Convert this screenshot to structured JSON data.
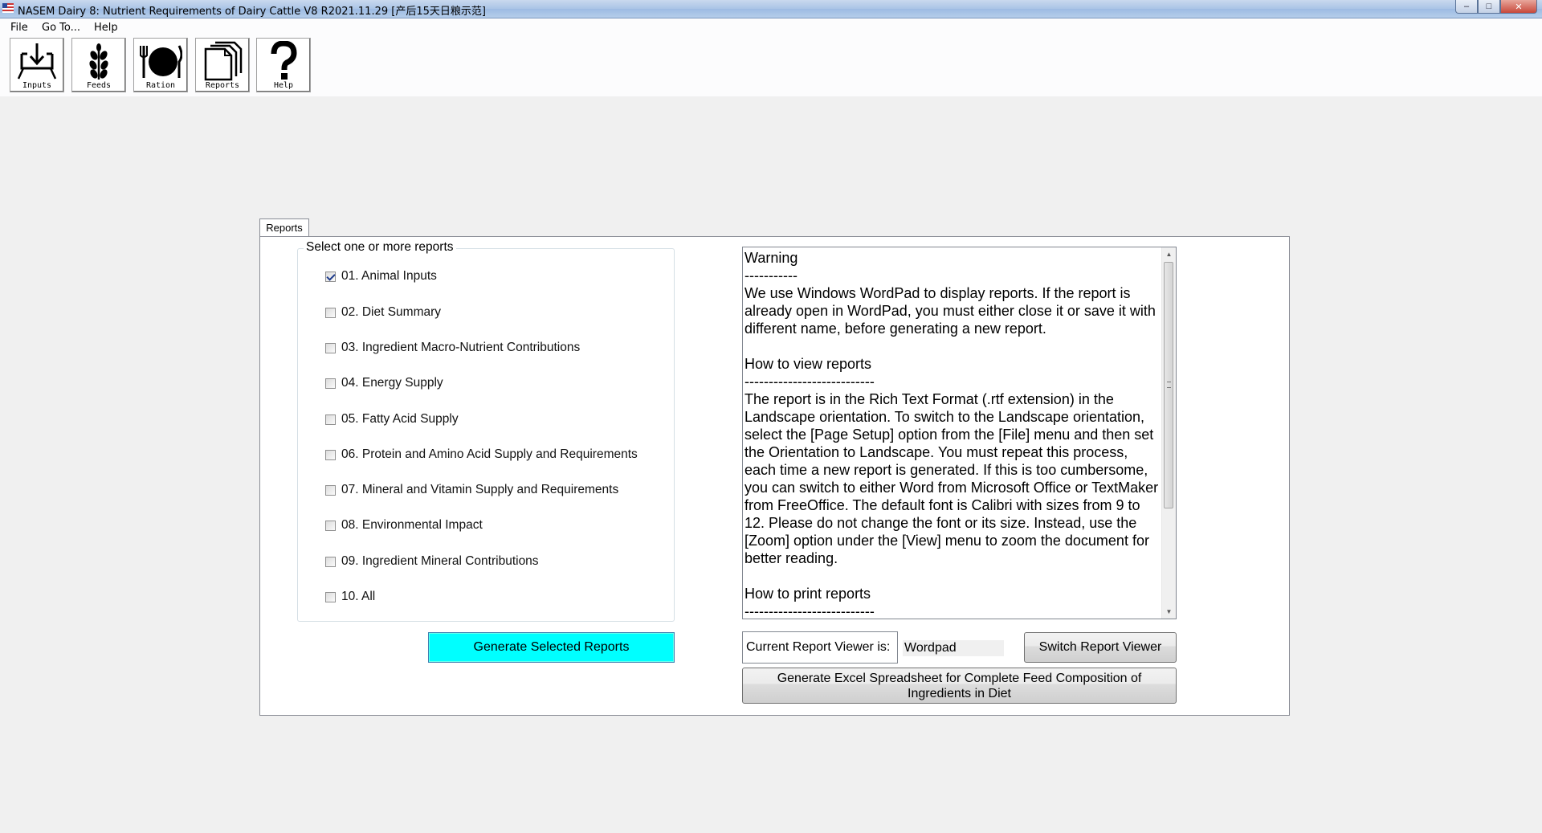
{
  "window": {
    "title": "NASEM Dairy 8: Nutrient Requirements of Dairy Cattle  V8 R2021.11.29 [产后15天日粮示范]",
    "controls": {
      "minimize": "–",
      "maximize": "□",
      "close": "✕"
    }
  },
  "menu": {
    "items": [
      "File",
      "Go To...",
      "Help"
    ]
  },
  "toolbar": {
    "buttons": [
      {
        "label": "Inputs",
        "icon": "inputs-icon"
      },
      {
        "label": "Feeds",
        "icon": "feeds-icon"
      },
      {
        "label": "Ration",
        "icon": "ration-icon"
      },
      {
        "label": "Reports",
        "icon": "reports-icon"
      },
      {
        "label": "Help",
        "icon": "help-icon"
      }
    ]
  },
  "tab": {
    "label": "Reports"
  },
  "reports": {
    "group_title": "Select one or more reports",
    "items": [
      {
        "label": "01. Animal Inputs",
        "checked": true
      },
      {
        "label": "02. Diet Summary",
        "checked": false
      },
      {
        "label": "03. Ingredient Macro-Nutrient Contributions",
        "checked": false
      },
      {
        "label": "04. Energy Supply",
        "checked": false
      },
      {
        "label": "05. Fatty Acid Supply",
        "checked": false
      },
      {
        "label": "06. Protein and Amino Acid Supply and Requirements",
        "checked": false
      },
      {
        "label": "07. Mineral and Vitamin Supply and Requirements",
        "checked": false
      },
      {
        "label": "08. Environmental Impact",
        "checked": false
      },
      {
        "label": "09. Ingredient Mineral Contributions",
        "checked": false
      },
      {
        "label": "10. All",
        "checked": false
      }
    ],
    "generate_button": "Generate Selected Reports"
  },
  "info_text": "Warning\n-----------\nWe use Windows WordPad to display reports. If the report is already open in WordPad, you must either close it or save it with different name, before generating a new report.\n\nHow to view reports\n---------------------------\nThe report is in the Rich Text Format (.rtf extension) in the Landscape orientation. To switch to the Landscape orientation, select the [Page Setup] option from the [File] menu and then set the Orientation to Landscape. You must repeat this process, each time a new report is generated. If this is too cumbersome, you can switch to either Word from Microsoft Office or TextMaker from FreeOffice. The default font is Calibri with sizes from 9 to 12. Please do not change the font or its size. Instead, use the [Zoom] option under the [View] menu to zoom the document for better reading.\n\nHow to print reports\n---------------------------",
  "viewer": {
    "label": "Current Report Viewer is:",
    "value": "Wordpad",
    "switch_button": "Switch Report Viewer",
    "excel_button": "Generate Excel Spreadsheet for Complete Feed Composition of Ingredients in Diet"
  }
}
